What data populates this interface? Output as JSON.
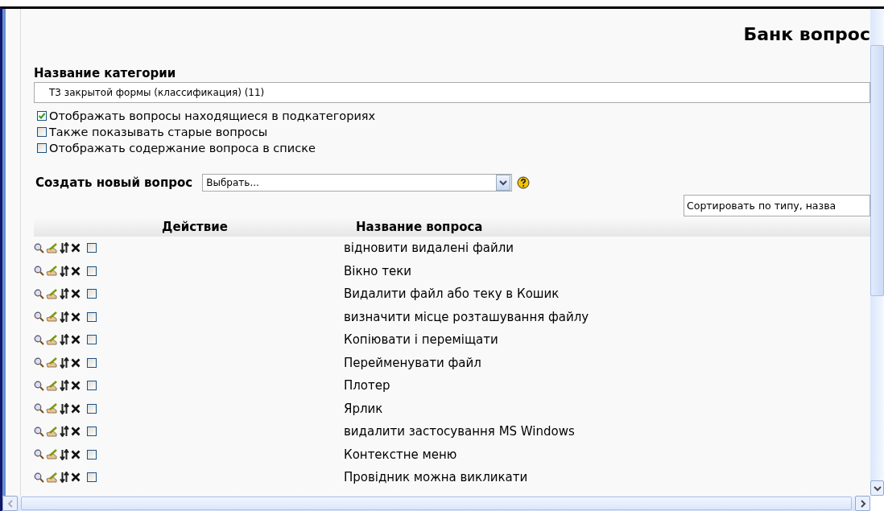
{
  "page_title": "Банк вопрос",
  "category": {
    "label": "Название категории",
    "value": "Т3 закрытой формы (классификация) (11)"
  },
  "options": [
    {
      "label": "Отображать вопросы находящиеся в подкатегориях",
      "checked": true
    },
    {
      "label": "Также показывать старые вопросы",
      "checked": false
    },
    {
      "label": "Отображать содержание вопроса в списке",
      "checked": false
    }
  ],
  "create": {
    "label": "Создать новый вопрос",
    "value": "Выбрать..."
  },
  "sort": {
    "value": "Сортировать по типу, назва"
  },
  "table": {
    "columns": [
      "Действие",
      "Название вопроса"
    ],
    "rows": [
      {
        "name": "відновити видалені файли",
        "checked": false
      },
      {
        "name": "Вікно теки",
        "checked": false
      },
      {
        "name": "Видалити файл або теку в Кошик",
        "checked": false
      },
      {
        "name": "визначити місце розташування файлу",
        "checked": false
      },
      {
        "name": "Копіювати і переміщати",
        "checked": false
      },
      {
        "name": "Перейменувати файл",
        "checked": false
      },
      {
        "name": "Плотер",
        "checked": false
      },
      {
        "name": "Ярлик",
        "checked": false
      },
      {
        "name": "видалити застосування MS Windows",
        "checked": false
      },
      {
        "name": "Контекстне меню",
        "checked": false
      },
      {
        "name": "Провідник можна викликати",
        "checked": false
      }
    ]
  }
}
